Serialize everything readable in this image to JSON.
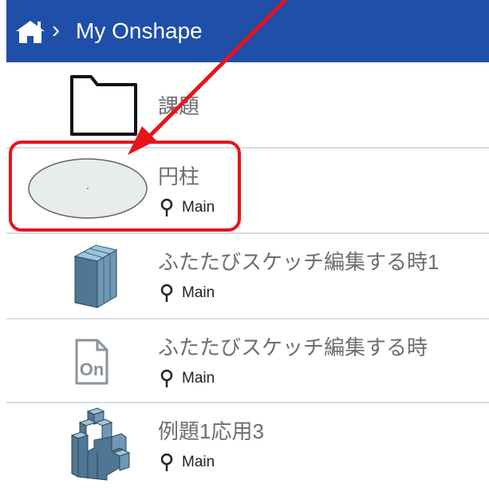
{
  "header": {
    "breadcrumb": "My Onshape"
  },
  "items": [
    {
      "title": "課題",
      "branch": "",
      "thumb": "folder-icon"
    },
    {
      "title": "円柱",
      "branch": "Main",
      "thumb": "cylinder-thumbnail"
    },
    {
      "title": "ふたたびスケッチ編集する時1",
      "branch": "Main",
      "thumb": "box-thumbnail"
    },
    {
      "title": "ふたたびスケッチ編集する時",
      "branch": "Main",
      "thumb": "onshape-logo-thumbnail"
    },
    {
      "title": "例題1応用3",
      "branch": "Main",
      "thumb": "stair-blocks-thumbnail"
    }
  ],
  "annotation": {
    "color": "#e8131b"
  },
  "colors": {
    "header": "#1f4fa8",
    "separator": "#d9dde3"
  }
}
